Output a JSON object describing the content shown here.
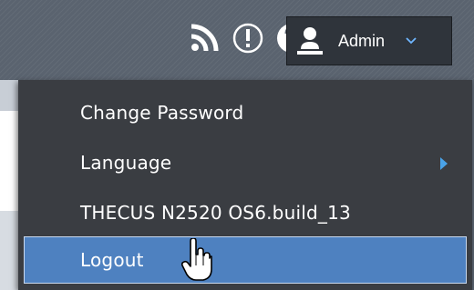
{
  "header": {
    "icons": [
      "rss-icon",
      "alert-icon",
      "help-icon"
    ],
    "user_menu": {
      "label": "Admin",
      "icon": "user-icon",
      "expanded": true
    }
  },
  "menu": {
    "items": [
      {
        "label": "Change Password"
      },
      {
        "label": "Language",
        "has_submenu": true
      },
      {
        "label": "THECUS N2520 OS6.build_13"
      },
      {
        "label": "Logout",
        "highlighted": true
      }
    ]
  },
  "colors": {
    "header_bg": "#5a636f",
    "menu_bg": "#3a3d42",
    "highlight": "#4e81c0",
    "submenu_arrow": "#4aa3e8"
  }
}
